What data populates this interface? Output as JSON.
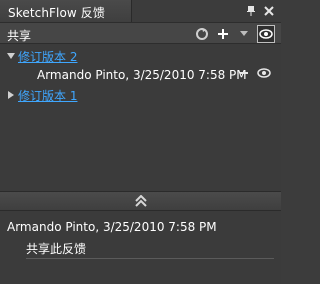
{
  "window": {
    "title": "SketchFlow 反馈"
  },
  "toolbar": {
    "label": "共享"
  },
  "revisions": [
    {
      "label": "修订版本 2",
      "expanded": true,
      "entries": [
        {
          "author_time": "Armando Pinto, 3/25/2010 7:58 PM"
        }
      ]
    },
    {
      "label": "修订版本 1",
      "expanded": false
    }
  ],
  "details": {
    "author_time": "Armando Pinto, 3/25/2010 7:58 PM",
    "comment": "共享此反馈"
  },
  "colors": {
    "link": "#3fa7ff",
    "panel_bg": "#3b3b3b",
    "text": "#ffffff"
  },
  "icons": {
    "pin": "pin-icon",
    "close": "close-icon",
    "refresh": "refresh-icon",
    "add": "plus-icon",
    "dropdown": "chevron-down-icon",
    "view": "eye-icon",
    "remove": "minus-icon",
    "collapse": "double-chevron-up-icon"
  }
}
